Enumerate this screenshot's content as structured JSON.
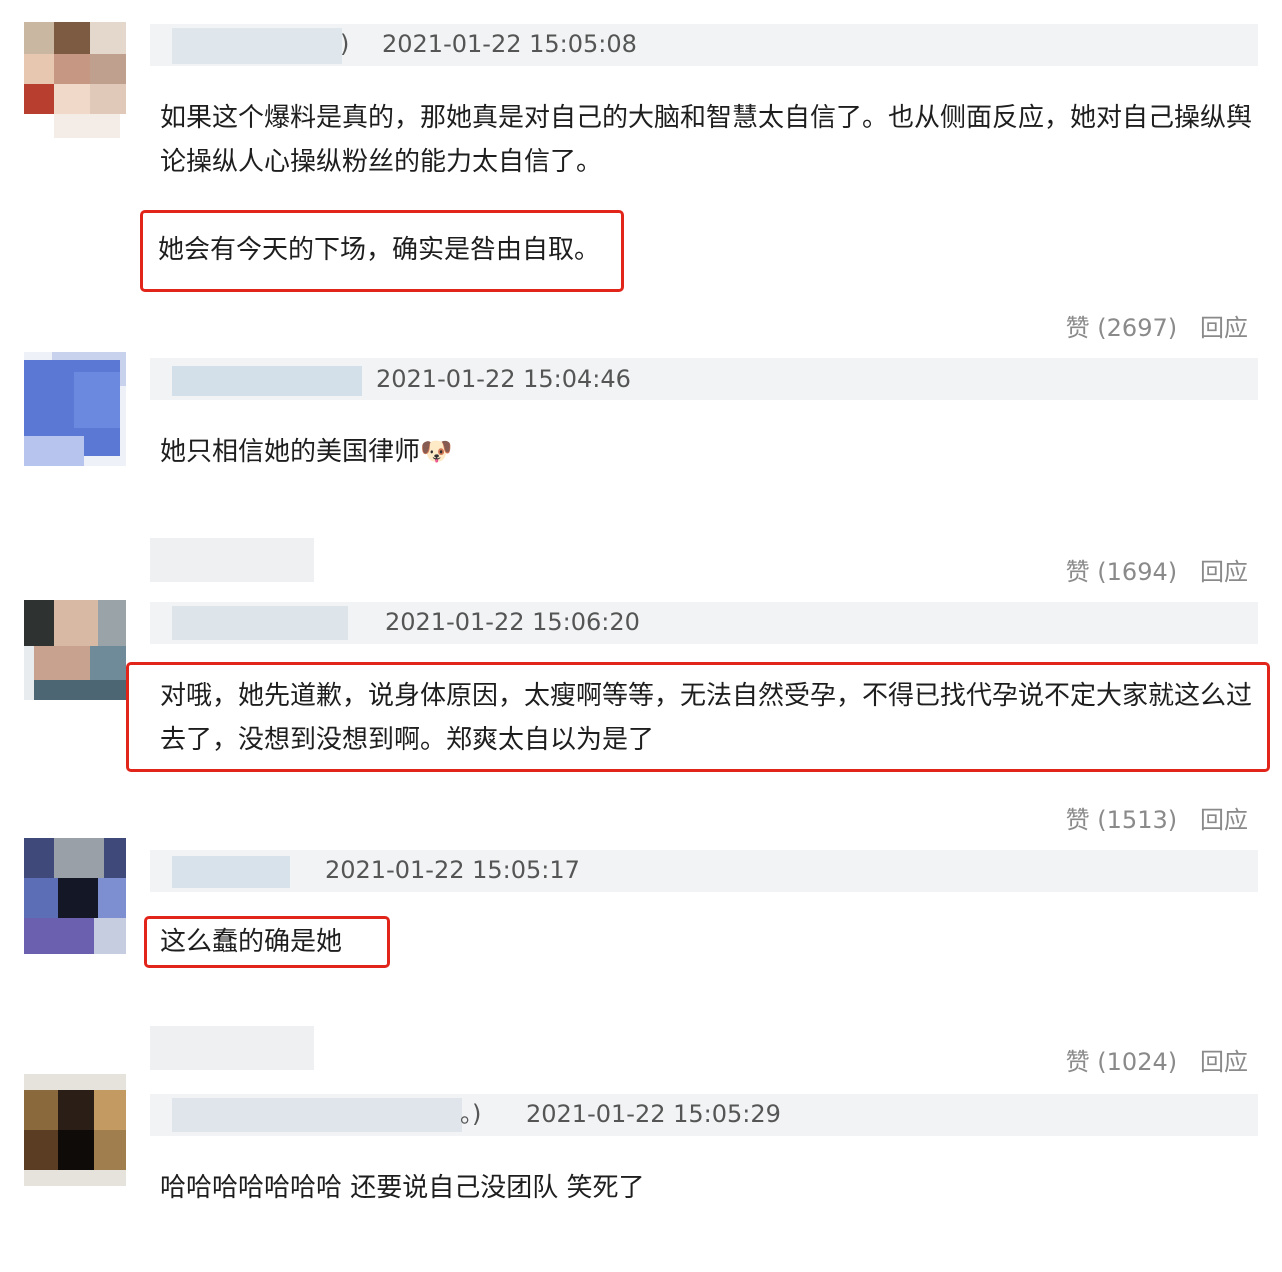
{
  "comments": [
    {
      "name_suffix": ")",
      "timestamp": "2021-01-22 15:05:08",
      "text_before": "如果这个爆料是真的，那她真是对自己的大脑和智慧太自信了。也从侧面反应，她对自己操纵舆论操纵人心操纵粉丝的能力太自信了。",
      "text_highlight": "她会有今天的下场，确实是咎由自取。",
      "likes_label": "赞 (2697)",
      "reply_label": "回应"
    },
    {
      "timestamp": "2021-01-22 15:04:46",
      "text": "她只相信她的美国律师",
      "emoji": "🐶",
      "likes_label": "赞 (1694)",
      "reply_label": "回应"
    },
    {
      "timestamp": "2021-01-22 15:06:20",
      "text_highlight": "对哦，她先道歉，说身体原因，太瘦啊等等，无法自然受孕，不得已找代孕说不定大家就这么过去了，没想到没想到啊。郑爽太自以为是了",
      "likes_label": "赞 (1513)",
      "reply_label": "回应"
    },
    {
      "timestamp": "2021-01-22 15:05:17",
      "text_highlight": "这么蠢的确是她",
      "likes_label": "赞 (1024)",
      "reply_label": "回应"
    },
    {
      "name_suffix": "。)",
      "timestamp": "2021-01-22 15:05:29",
      "text": "哈哈哈哈哈哈哈 还要说自己没团队 笑死了"
    }
  ],
  "colors": {
    "highlight_border": "#e1251b",
    "meta_band": "#f1f3f4",
    "action_text": "#8a8a8a"
  }
}
